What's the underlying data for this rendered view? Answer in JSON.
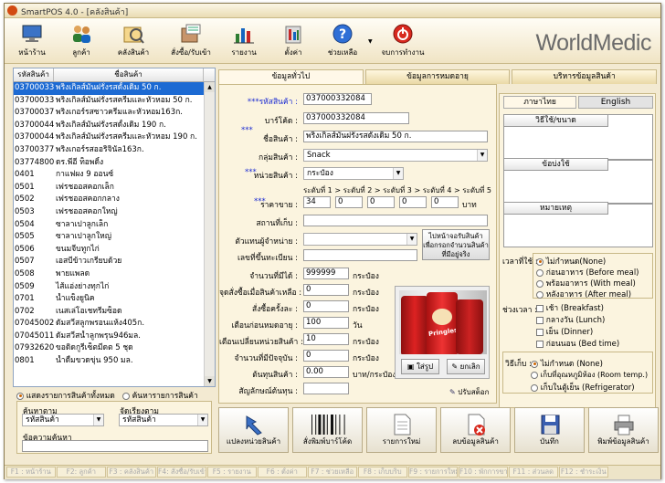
{
  "window": {
    "title": "SmartPOS 4.0 - [คลังสินค้า]",
    "brand": "WorldMedic"
  },
  "toolbar": [
    {
      "label": "หน้าร้าน",
      "icon": "monitor-icon"
    },
    {
      "label": "ลูกค้า",
      "icon": "customers-icon"
    },
    {
      "label": "คลังสินค้า",
      "icon": "warehouse-icon"
    },
    {
      "label": "สั่งซื้อ/รับเข้า",
      "icon": "purchase-icon"
    },
    {
      "label": "รายงาน",
      "icon": "report-chart-icon"
    },
    {
      "label": "ตั้งค่า",
      "icon": "settings-icon"
    },
    {
      "label": "ช่วยเหลือ",
      "icon": "help-icon"
    },
    {
      "label": "จบการทำงาน",
      "icon": "power-icon"
    }
  ],
  "list": {
    "headers": [
      "รหัสสินค้า",
      "ชื่อสินค้า"
    ],
    "rows": [
      [
        "037000332084",
        "พริงเกิลส์มันฝรั่งรสดั้งเดิม 50 ก."
      ],
      [
        "037000332077",
        "พริงเกิลส์มันฝรั่งรสครีมและหัวหอม 50 ก."
      ],
      [
        "037000377",
        "พริงเกอร์รสซาวครีมและหัวหอม163ก."
      ],
      [
        "037000440",
        "พริงเกิลส์มันฝรั่งรสดั้งเดิม 190 ก."
      ],
      [
        "037000445",
        "พริงเกิลส์มันฝรั่งรสครีมและหัวหอม 190 ก."
      ],
      [
        "037003770",
        "พริงเกอร์รสออริจินัล163ก."
      ],
      [
        "037748000",
        "ดร.พีอี ท็อพดิ้ง"
      ],
      [
        "0401",
        "กาแฟผง 9 ออนซ์"
      ],
      [
        "0501",
        "เฟรชออสคอกเล็ก"
      ],
      [
        "0502",
        "เฟรชออสคอกกลาง"
      ],
      [
        "0503",
        "เฟรชออสคอกใหญ่"
      ],
      [
        "0504",
        "ซาลาเปาลูกเล็ก"
      ],
      [
        "0505",
        "ซาลาเปาลูกใหญ่"
      ],
      [
        "0506",
        "ขนมจีบทูกไก่"
      ],
      [
        "0507",
        "เอสบีข้าวเกรียบด้วย"
      ],
      [
        "0508",
        "พายแพลด"
      ],
      [
        "0509",
        "ไส้แอ่งย่างทุกไก่"
      ],
      [
        "0701",
        "น้ำแข็งยูนิค"
      ],
      [
        "0702",
        "เนสเล่โอเชทรีมซ็อด"
      ],
      [
        "070450021",
        "ดัมสวีสลูกพรอนแห้ง405ก."
      ],
      [
        "070450113",
        "ดัมสวีสน้ำลูกพรุน946มล."
      ],
      [
        "079326200",
        "ขอดิดกูรีเซ็ตมีดต 5 ชุด"
      ],
      [
        "0801",
        "น้ำดื่มขวดขุ่น 950 มล."
      ]
    ]
  },
  "filters": {
    "show_all": "แสดงรายการสินค้าทั้งหมด",
    "show_search": "ค้นหารายการสินค้า",
    "search_by_label": "ค้นหาตาม",
    "search_by_value": "รหัสสินค้า",
    "sort_by_label": "จัดเรียงตาม",
    "sort_by_value": "รหัสสินค้า",
    "search_text_label": "ข้อความค้นหา",
    "search_text_value": ""
  },
  "tabs": [
    "ข้อมูลทั่วไป",
    "ข้อมูลการหมดอายุ",
    "บริหารข้อมูลสินค้า"
  ],
  "form": {
    "code_label": "***รหัสสินค้า :",
    "code": "037000332084",
    "barcode_label": "บาร์โค้ด :",
    "barcode": "037000332084",
    "name_label": "ชื่อสินค้า :",
    "name_req": "***",
    "name": "พริงเกิลส์มันฝรั่งรสดั้งเดิม 50 ก.",
    "group_label": "กลุ่มสินค้า :",
    "group": "Snack",
    "unit_label": "หน่วยสินค้า :",
    "unit_req": "***",
    "unit": "กระป๋อง",
    "levels_header": "ระดับที่ 1 > ระดับที่ 2 > ระดับที่ 3 > ระดับที่ 4 > ระดับที่ 5",
    "price_label": "ราคาขาย :",
    "price_req": "***",
    "prices": [
      "34",
      "0",
      "0",
      "0",
      "0"
    ],
    "price_unit": "บาท",
    "location_label": "สถานที่เก็บ :",
    "location": "",
    "supplier_label": "ตัวแทนผู้จำหน่าย :",
    "supplier": "",
    "tax_label": "เลขที่ขึ้นทะเบียน :",
    "tax": "",
    "qty_label": "จำนวนที่มีได้ :",
    "qty": "999999",
    "qty_unit": "กระป๋อง",
    "reorder_label": "จุดสั่งซื้อเมื่อสินค้าเหลือ :",
    "reorder": "0",
    "reorder_unit": "กระป๋อง",
    "order_each_label": "สั่งซื้อครั้งละ :",
    "order_each": "0",
    "order_each_unit": "กระป๋อง",
    "expire_warn_label": "เตือนก่อนหมดอายุ :",
    "expire_warn": "100",
    "expire_warn_unit": "วัน",
    "unit_warn_label": "เตือนเปลี่ยนหน่วยสินค้า :",
    "unit_warn": "10",
    "unit_warn_unit": "กระป๋อง",
    "current_label": "จำนวนที่มีปัจจุบัน :",
    "current": "0",
    "current_unit": "กระป๋อง",
    "cost_label": "ต้นทุนสินค้า :",
    "cost": "0.00",
    "cost_unit": "บาท/กระป๋อง",
    "vat_label": "สัญลักษณ์ต้นทุน :",
    "vat": "",
    "supplier_btn": "ไปหน้าจอรับสินค้า เพื่อกรอกจำนวนสินค้าที่มีอยู่จริง",
    "photo_add": "ใส่รูป",
    "photo_cancel": "ยกเลิก",
    "photo_caption": "Pringles",
    "adjust_stock": "ปรับสต็อก"
  },
  "right": {
    "tab_thai": "ภาษาไทย",
    "tab_en": "English",
    "usage_label": "วิธีใช้/ขนาด",
    "indication_label": "ข้อบ่งใช้",
    "note_label": "หมายเหตุ",
    "time_label": "เวลาที่ใช้ :",
    "time_options": [
      "ไม่กำหนด(None)",
      "ก่อนอาหาร (Before meal)",
      "พร้อมอาหาร (With meal)",
      "หลังอาหาร (After meal)"
    ],
    "period_label": "ช่วงเวลา :",
    "period_options": [
      "เช้า (Breakfast)",
      "กลางวัน (Lunch)",
      "เย็น (Dinner)",
      "ก่อนนอน (Bed time)"
    ],
    "store_label": "วิธีเก็บ :",
    "store_options": [
      "ไม่กำหนด (None)",
      "เก็บที่อุณหภูมิห้อง (Room temp.)",
      "เก็บในตู้เย็น (Refrigerator)"
    ]
  },
  "actions": [
    {
      "label": "แปลงหน่วยสินค้า",
      "icon": "convert-icon"
    },
    {
      "label": "สั่งพิมพ์บาร์โค้ด",
      "icon": "barcode-icon"
    },
    {
      "label": "รายการใหม่",
      "icon": "new-document-icon"
    },
    {
      "label": "ลบข้อมูลสินค้า",
      "icon": "delete-icon"
    },
    {
      "label": "บันทึก",
      "icon": "save-disk-icon"
    },
    {
      "label": "พิมพ์ข้อมูลสินค้า",
      "icon": "printer-icon"
    }
  ],
  "status_keys": [
    "F1 : หน้าร้าน",
    "F2: ลูกค้า",
    "F3 : คลังสินค้า",
    "F4: สั่งซื้อ/รับเข้า",
    "F5 : รายงาน",
    "F6 : ตั้งค่า",
    "F7 : ช่วยเหลือ",
    "F8 : เก็บบริบ",
    "F9 : รายการใหม่",
    "F10 : พักการขาย",
    "F11 : ส่วนลด",
    "F12 : ชำระเงิน"
  ]
}
